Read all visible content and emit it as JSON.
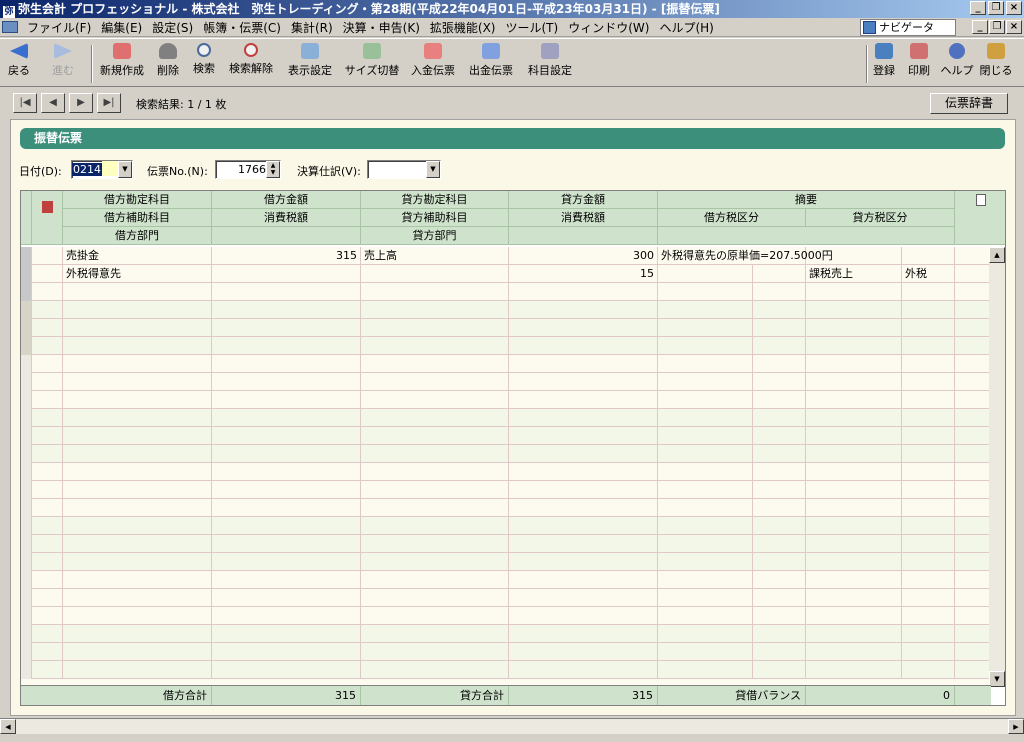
{
  "title": "弥生会計 プロフェッショナル - 株式会社　弥生トレーディング・第28期(平成22年04月01日-平成23年03月31日) - [振替伝票]",
  "menu": [
    "ファイル(F)",
    "編集(E)",
    "設定(S)",
    "帳簿・伝票(C)",
    "集計(R)",
    "決算・申告(K)",
    "拡張機能(X)",
    "ツール(T)",
    "ウィンドウ(W)",
    "ヘルプ(H)"
  ],
  "navigator": "ナビゲータ",
  "toolbar": {
    "back": "戻る",
    "forward": "進む",
    "new": "新規作成",
    "delete": "削除",
    "search": "検索",
    "clear_search": "検索解除",
    "display": "表示設定",
    "size": "サイズ切替",
    "receipt": "入金伝票",
    "payment": "出金伝票",
    "accounts": "科目設定",
    "register": "登録",
    "print": "印刷",
    "help": "ヘルプ",
    "close": "閉じる"
  },
  "nav": {
    "result": "検索結果: 1 / 1 枚",
    "dict": "伝票辞書"
  },
  "voucher": {
    "header": "振替伝票",
    "date_label": "日付(D):",
    "date_value": "0214",
    "no_label": "伝票No.(N):",
    "no_value": "1766",
    "closing_label": "決算仕訳(V):",
    "closing_value": ""
  },
  "columns": {
    "debit_account": "借方勘定科目",
    "debit_amount": "借方金額",
    "credit_account": "貸方勘定科目",
    "credit_amount": "貸方金額",
    "memo": "摘要",
    "debit_sub": "借方補助科目",
    "tax1": "消費税額",
    "credit_sub": "貸方補助科目",
    "tax2": "消費税額",
    "debit_tax_cat": "借方税区分",
    "credit_tax_cat": "貸方税区分",
    "debit_dept": "借方部門",
    "credit_dept": "貸方部門"
  },
  "entry": {
    "debit_account": "売掛金",
    "debit_amount": "315",
    "credit_account": "売上高",
    "credit_amount": "300",
    "memo": "外税得意先の原単価=207.5000円",
    "debit_sub": "外税得意先",
    "credit_tax": "15",
    "credit_tax_cat": "課税売上",
    "credit_tax_type": "外税"
  },
  "totals": {
    "debit_label": "借方合計",
    "debit": "315",
    "credit_label": "貸方合計",
    "credit": "315",
    "balance_label": "貸借バランス",
    "balance": "0"
  }
}
